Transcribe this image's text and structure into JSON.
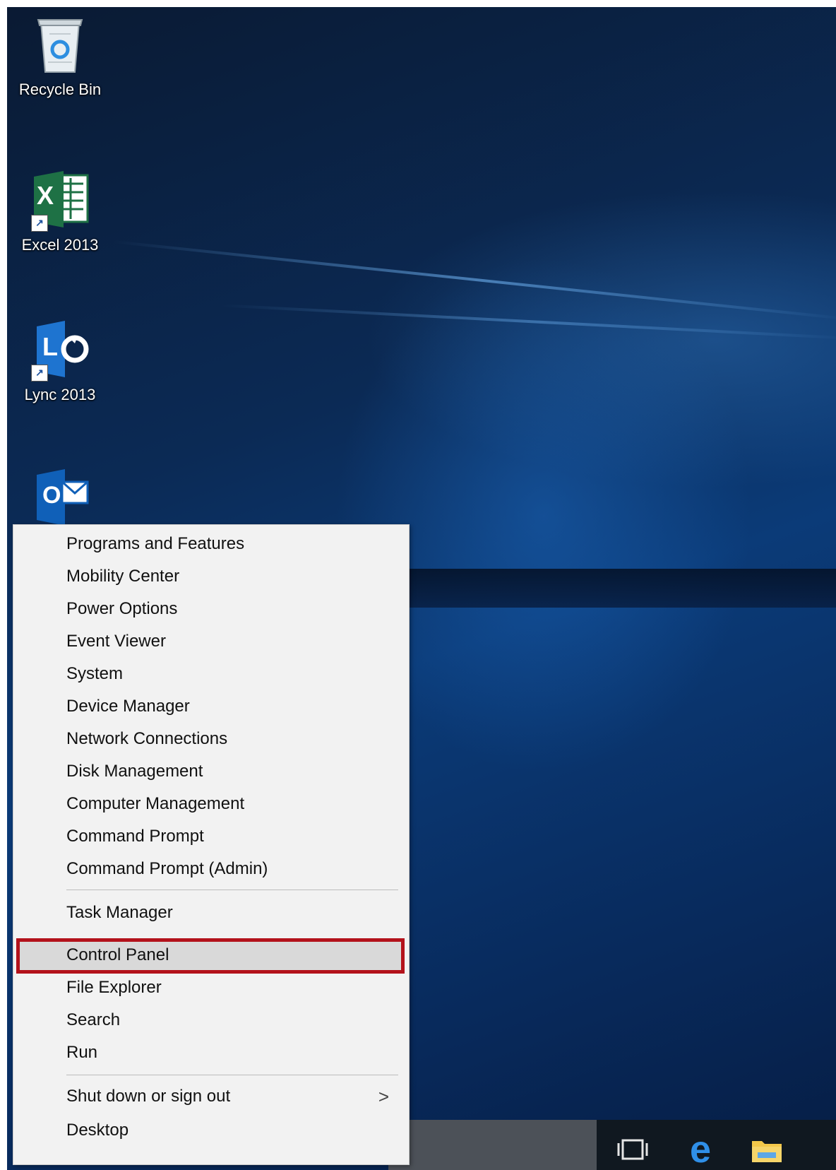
{
  "desktop_icons": [
    {
      "label": "Recycle Bin",
      "icon": "recycle-bin-icon"
    },
    {
      "label": "Excel 2013",
      "icon": "excel-icon"
    },
    {
      "label": "Lync 2013",
      "icon": "lync-icon"
    },
    {
      "label": "",
      "icon": "outlook-icon"
    }
  ],
  "excel_letter": "X",
  "lync_letter": "L",
  "outlook_letter": "O",
  "menu": {
    "items_group1": [
      "Programs and Features",
      "Mobility Center",
      "Power Options",
      "Event Viewer",
      "System",
      "Device Manager",
      "Network Connections",
      "Disk Management",
      "Computer Management",
      "Command Prompt",
      "Command Prompt (Admin)"
    ],
    "items_group2": [
      "Task Manager",
      "Control Panel",
      "File Explorer",
      "Search",
      "Run"
    ],
    "items_group3": [
      "Shut down or sign out",
      "Desktop"
    ],
    "highlighted_item": "Control Panel",
    "submenu_arrow": ">"
  },
  "taskbar": {
    "icons": [
      "task-view-icon",
      "edge-icon",
      "file-explorer-icon"
    ],
    "edge_letter": "e"
  },
  "colors": {
    "highlight_border": "#b3121b",
    "menu_bg": "#f2f2f2",
    "desktop_blue": "#0b3b78"
  }
}
